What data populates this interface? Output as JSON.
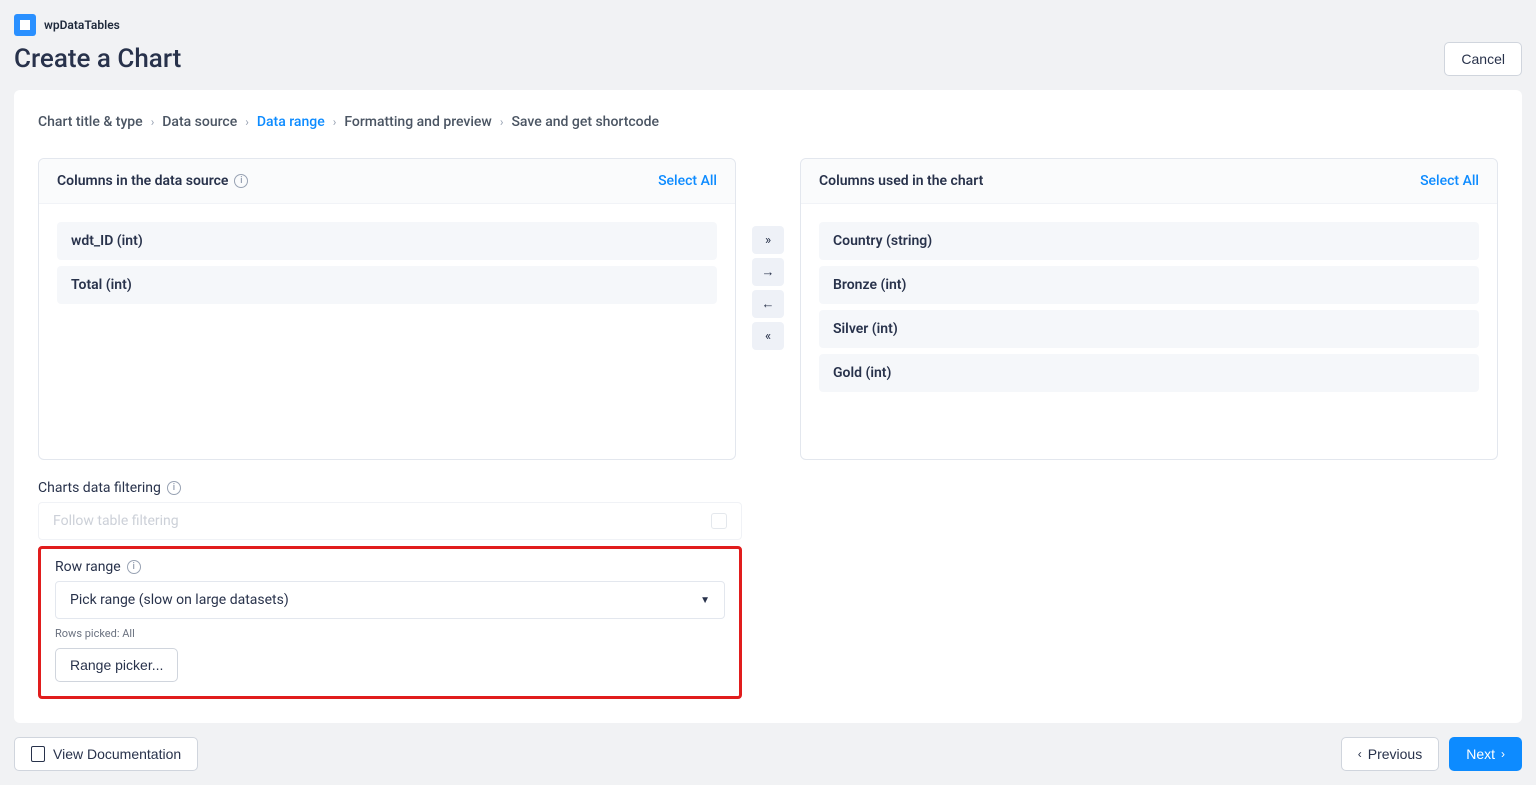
{
  "brand": {
    "name": "wpDataTables"
  },
  "page_title": "Create a Chart",
  "cancel_label": "Cancel",
  "breadcrumb": {
    "item0": "Chart title & type",
    "item1": "Data source",
    "item2": "Data range",
    "item3": "Formatting and preview",
    "item4": "Save and get shortcode"
  },
  "source_panel": {
    "title": "Columns in the data source",
    "select_all": "Select All",
    "items": {
      "i0": "wdt_ID (int)",
      "i1": "Total (int)"
    }
  },
  "used_panel": {
    "title": "Columns used in the chart",
    "select_all": "Select All",
    "items": {
      "i0": "Country (string)",
      "i1": "Bronze (int)",
      "i2": "Silver (int)",
      "i3": "Gold (int)"
    }
  },
  "filtering": {
    "label": "Charts data filtering",
    "follow": "Follow table filtering"
  },
  "row_range": {
    "label": "Row range",
    "select_value": "Pick range (slow on large datasets)",
    "rows_picked": "Rows picked: All",
    "picker_button": "Range picker..."
  },
  "footer": {
    "docs": "View Documentation",
    "previous": "Previous",
    "next": "Next"
  }
}
